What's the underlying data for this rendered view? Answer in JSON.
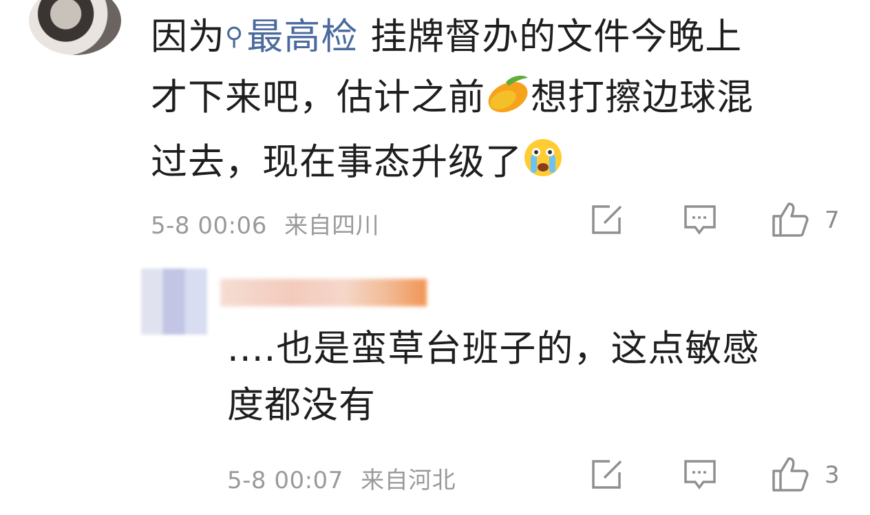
{
  "comment": {
    "topic": "最高检",
    "text_before_topic": "因为",
    "text_line1_rest": " 挂牌督办的文件今晚上",
    "text_line2_a": "才下来吧，估计之前",
    "text_line2_b": "想打擦边球混",
    "text_line3": "过去，现在事态升级了",
    "time": "5-8 00:06",
    "location": "来自四川",
    "like_count": "7",
    "emojis": [
      "mango-emoji",
      "crying-face-emoji"
    ]
  },
  "reply": {
    "text_line1": "....也是蛮草台班子的，这点敏感",
    "text_line2": "度都没有",
    "time": "5-8 00:07",
    "location": "来自河北",
    "like_count": "3"
  },
  "icons": {
    "share": "share-edit-icon",
    "comment": "comment-bubble-icon",
    "like": "thumbs-up-icon"
  },
  "colors": {
    "text": "#1e1e1e",
    "topic": "#4a6a9e",
    "meta": "#9a9a9a"
  }
}
